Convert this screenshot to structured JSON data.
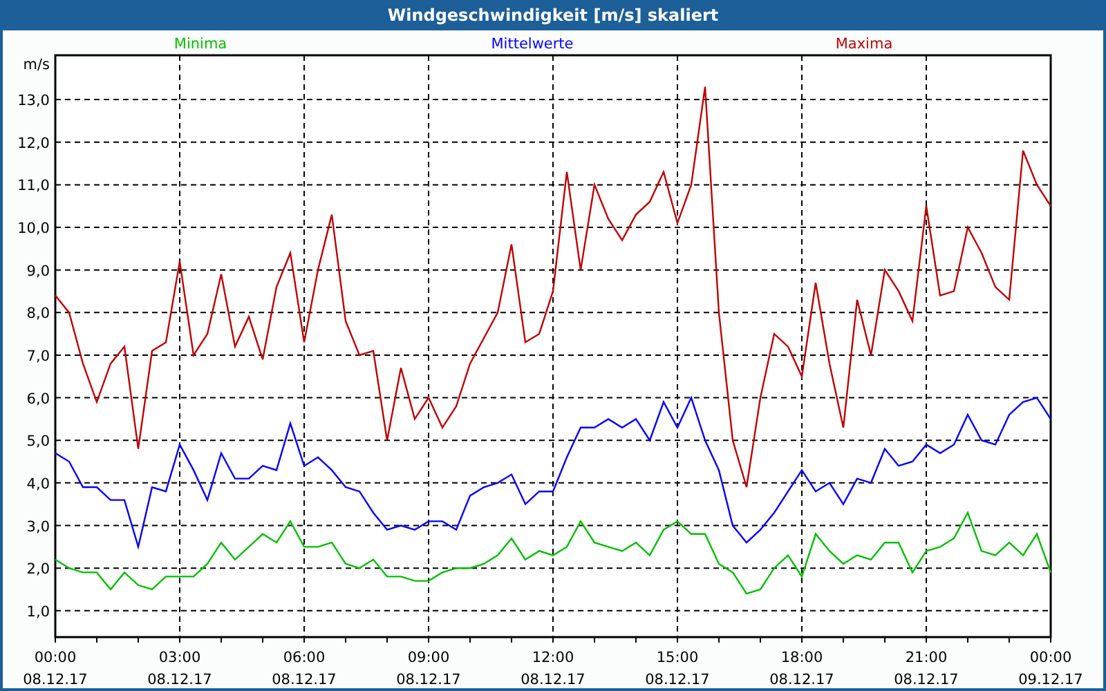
{
  "window": {
    "title": "Windgeschwindigkeit [m/s] skaliert"
  },
  "chart": {
    "chart_data": {
      "type": "line",
      "ylabel": "m/s",
      "ylim": [
        0.38,
        14.04
      ],
      "categories": [
        "00:00\n08.12.17",
        null,
        null,
        null,
        null,
        null,
        null,
        null,
        null,
        "03:00\n08.12.17",
        null,
        null,
        null,
        null,
        null,
        null,
        null,
        null,
        "06:00\n08.12.17",
        null,
        null,
        null,
        null,
        null,
        null,
        null,
        null,
        "09:00\n08.12.17",
        null,
        null,
        null,
        null,
        null,
        null,
        null,
        null,
        "12:00\n08.12.17",
        null,
        null,
        null,
        null,
        null,
        null,
        null,
        null,
        "15:00\n08.12.17",
        null,
        null,
        null,
        null,
        null,
        null,
        null,
        null,
        "18:00\n08.12.17",
        null,
        null,
        null,
        null,
        null,
        null,
        null,
        null,
        "21:00\n08.12.17",
        null,
        null,
        null,
        null,
        null,
        null,
        null,
        null,
        "00:00\n09.12.17"
      ],
      "series": [
        {
          "name": "Minima",
          "color": "#00c000",
          "values": [
            2.2,
            2.0,
            1.9,
            1.9,
            1.5,
            1.9,
            1.6,
            1.5,
            1.8,
            1.8,
            1.8,
            2.1,
            2.6,
            2.2,
            2.5,
            2.8,
            2.6,
            3.1,
            2.5,
            2.5,
            2.6,
            2.1,
            2.0,
            2.2,
            1.8,
            1.8,
            1.7,
            1.7,
            1.9,
            2.0,
            2.0,
            2.1,
            2.3,
            2.7,
            2.2,
            2.4,
            2.3,
            2.5,
            3.1,
            2.6,
            2.5,
            2.4,
            2.6,
            2.3,
            2.9,
            3.1,
            2.8,
            2.8,
            2.1,
            1.9,
            1.4,
            1.5,
            2.0,
            2.3,
            1.8,
            2.8,
            2.4,
            2.1,
            2.3,
            2.2,
            2.6,
            2.6,
            1.9,
            2.4,
            2.5,
            2.7,
            3.3,
            2.4,
            2.3,
            2.6,
            2.3,
            2.8,
            1.9
          ]
        },
        {
          "name": "Mittelwerte",
          "color": "#0000ff",
          "values": [
            4.7,
            4.5,
            3.9,
            3.9,
            3.6,
            3.6,
            2.5,
            3.9,
            3.8,
            4.9,
            4.3,
            3.6,
            4.7,
            4.1,
            4.1,
            4.4,
            4.3,
            5.4,
            4.4,
            4.6,
            4.3,
            3.9,
            3.8,
            3.3,
            2.9,
            3.0,
            2.9,
            3.1,
            3.1,
            2.9,
            3.7,
            3.9,
            4.0,
            4.2,
            3.5,
            3.8,
            3.8,
            4.6,
            5.3,
            5.3,
            5.5,
            5.3,
            5.5,
            5.0,
            5.9,
            5.3,
            6.0,
            5.0,
            4.3,
            3.0,
            2.6,
            2.9,
            3.3,
            3.8,
            4.3,
            3.8,
            4.0,
            3.5,
            4.1,
            4.0,
            4.8,
            4.4,
            4.5,
            4.9,
            4.7,
            4.9,
            5.6,
            5.0,
            4.9,
            5.6,
            5.9,
            6.0,
            5.5
          ]
        },
        {
          "name": "Maxima",
          "color": "#c00000",
          "values": [
            8.4,
            8.0,
            6.8,
            5.9,
            6.8,
            7.2,
            4.8,
            7.1,
            7.3,
            9.2,
            7.0,
            7.5,
            8.9,
            7.2,
            7.9,
            6.9,
            8.6,
            9.4,
            7.3,
            9.0,
            10.3,
            7.8,
            7.0,
            7.1,
            5.0,
            6.7,
            5.5,
            6.0,
            5.3,
            5.8,
            6.8,
            7.4,
            8.0,
            9.6,
            7.3,
            7.5,
            8.5,
            11.3,
            9.0,
            11.0,
            10.2,
            9.7,
            10.3,
            10.6,
            11.3,
            10.1,
            11.0,
            13.3,
            8.0,
            5.0,
            3.9,
            6.0,
            7.5,
            7.2,
            6.5,
            8.7,
            6.8,
            5.3,
            8.3,
            7.0,
            9.0,
            8.5,
            7.8,
            10.5,
            8.4,
            8.5,
            10.0,
            9.4,
            8.6,
            8.3,
            11.8,
            11.0,
            10.5
          ]
        }
      ],
      "grid": true,
      "yticks": [
        {
          "value": 1,
          "label": "1,0"
        },
        {
          "value": 2,
          "label": "2,0"
        },
        {
          "value": 3,
          "label": "3,0"
        },
        {
          "value": 4,
          "label": "4,0"
        },
        {
          "value": 5,
          "label": "5,0"
        },
        {
          "value": 6,
          "label": "6,0"
        },
        {
          "value": 7,
          "label": "7,0"
        },
        {
          "value": 8,
          "label": "8,0"
        },
        {
          "value": 9,
          "label": "9,0"
        },
        {
          "value": 10,
          "label": "10,0"
        },
        {
          "value": 11,
          "label": "11,0"
        },
        {
          "value": 12,
          "label": "12,0"
        },
        {
          "value": 13,
          "label": "13,0"
        }
      ]
    }
  }
}
